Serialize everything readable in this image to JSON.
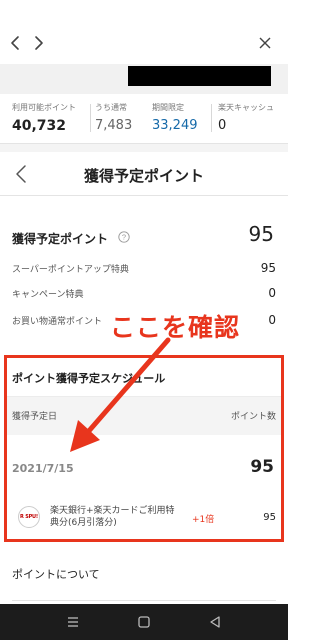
{
  "points_summary": {
    "available_label": "利用可能ポイント",
    "available_value": "40,732",
    "regular_label": "うち通常",
    "regular_value": "7,483",
    "limited_label": "期間限定",
    "limited_value": "33,249",
    "cash_label": "楽天キャッシュ",
    "cash_value": "0"
  },
  "page": {
    "title": "獲得予定ポイント"
  },
  "summary": {
    "title": "獲得予定ポイント",
    "total": "95",
    "rows": [
      {
        "label": "スーパーポイントアップ特典",
        "value": "95"
      },
      {
        "label": "キャンペーン特典",
        "value": "0"
      },
      {
        "label": "お買い物通常ポイント",
        "value": "0"
      }
    ]
  },
  "annotation": {
    "text": "ここを確認",
    "color": "#e8351d"
  },
  "schedule": {
    "title": "ポイント獲得予定スケジュール",
    "col_date": "獲得予定日",
    "col_points": "ポイント数",
    "date": "2021/7/15",
    "amount": "95",
    "bonus_logo": "R SPU!",
    "bonus_desc": "楽天銀行+楽天カードご利用特典分(6月引落分)",
    "bonus_mult": "+1倍",
    "bonus_points": "95"
  },
  "about": {
    "title": "ポイントについて"
  },
  "icons": {
    "browser_back": "chevron-left-icon",
    "browser_forward": "chevron-right-icon",
    "browser_close": "close-icon",
    "page_back": "chevron-left-icon",
    "help": "question-circle-icon",
    "nav_recents": "menu-icon",
    "nav_home": "square-icon",
    "nav_back": "triangle-back-icon"
  }
}
